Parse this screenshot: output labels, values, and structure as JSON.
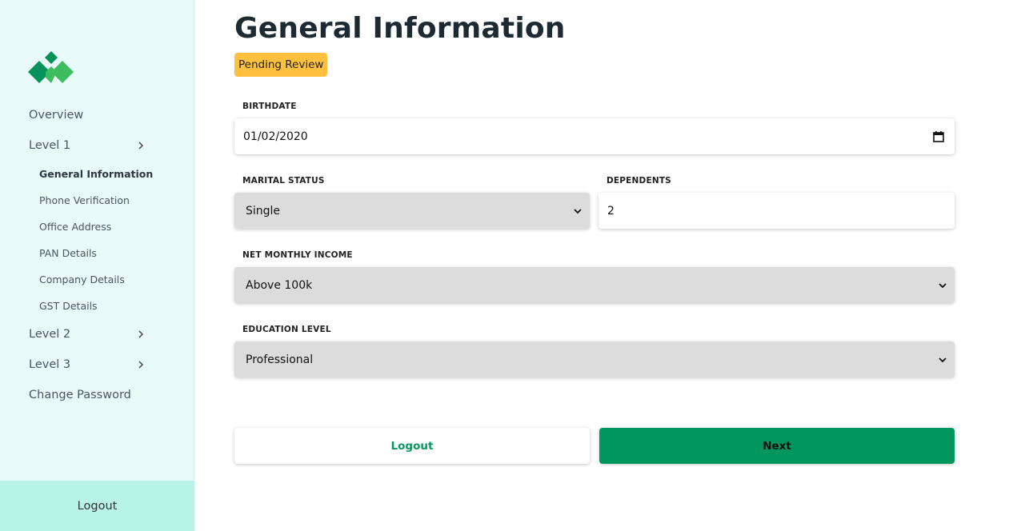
{
  "sidebar": {
    "logo_colors": {
      "dark": "#07925c",
      "light": "#3ebd5e"
    },
    "items": [
      {
        "label": "Overview"
      },
      {
        "label": "Level 1",
        "icon": "chevron-right-icon"
      },
      {
        "label": "Level 2",
        "icon": "chevron-right-icon"
      },
      {
        "label": "Level 3",
        "icon": "chevron-right-icon"
      },
      {
        "label": "Change Password"
      }
    ],
    "sub_items": [
      {
        "label": "General Information",
        "active": true
      },
      {
        "label": "Phone Verification"
      },
      {
        "label": "Office Address"
      },
      {
        "label": "PAN Details"
      },
      {
        "label": "Company Details"
      },
      {
        "label": "GST Details"
      }
    ],
    "logout_label": "Logout"
  },
  "main": {
    "title": "General Information",
    "status_badge": "Pending Review",
    "fields": {
      "birthdate": {
        "label": "BIRTHDATE",
        "value": "01/02/2020",
        "icon": "calendar-icon"
      },
      "marital_status": {
        "label": "MARITAL STATUS",
        "value": "Single"
      },
      "dependents": {
        "label": "DEPENDENTS",
        "value": "2"
      },
      "net_monthly_income": {
        "label": "NET MONTHLY INCOME",
        "value": "Above 100k"
      },
      "education_level": {
        "label": "EDUCATION LEVEL",
        "value": "Professional"
      }
    },
    "buttons": {
      "logout": "Logout",
      "next": "Next"
    }
  },
  "colors": {
    "accent": "#00965e",
    "badge": "#ffc13d",
    "sidebar_bg": "#e8fbf8",
    "sidebar_footer_bg": "#b8f3e8"
  }
}
